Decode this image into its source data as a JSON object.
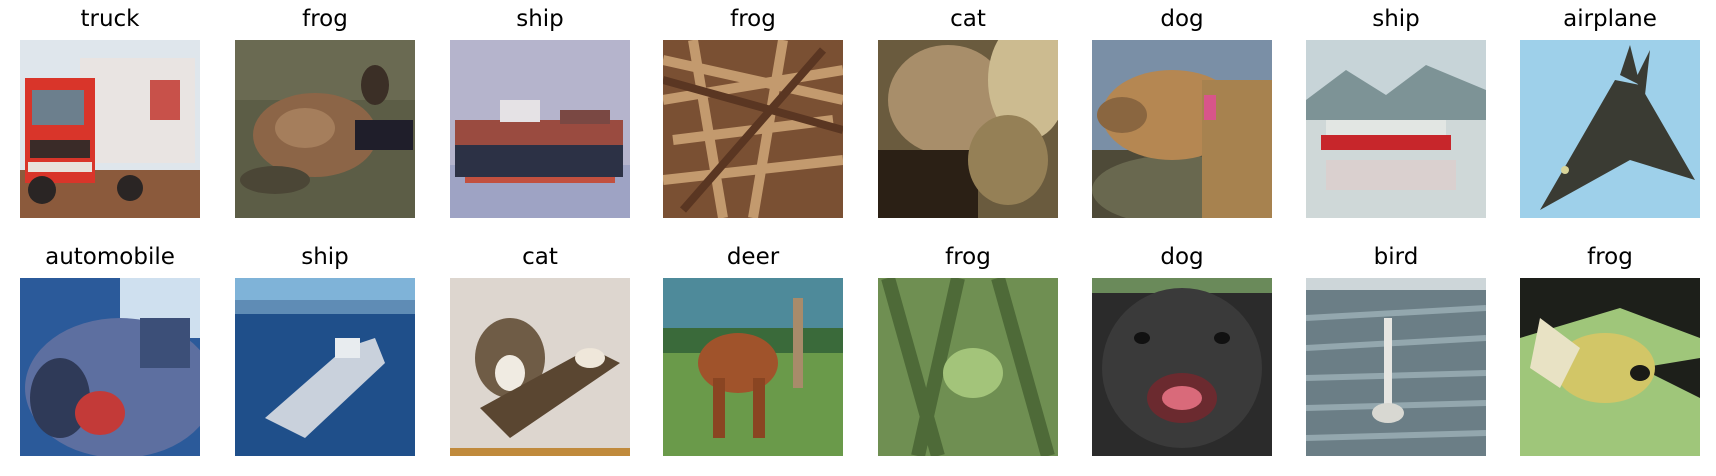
{
  "figure": {
    "rows": [
      [
        {
          "label": "truck",
          "icon": "truck-photo"
        },
        {
          "label": "frog",
          "icon": "frog-photo"
        },
        {
          "label": "ship",
          "icon": "ship-photo"
        },
        {
          "label": "frog",
          "icon": "frog-photo"
        },
        {
          "label": "cat",
          "icon": "cat-photo"
        },
        {
          "label": "dog",
          "icon": "dog-photo"
        },
        {
          "label": "ship",
          "icon": "ship-photo"
        },
        {
          "label": "airplane",
          "icon": "airplane-photo"
        }
      ],
      [
        {
          "label": "automobile",
          "icon": "automobile-photo"
        },
        {
          "label": "ship",
          "icon": "ship-photo"
        },
        {
          "label": "cat",
          "icon": "cat-photo"
        },
        {
          "label": "deer",
          "icon": "deer-photo"
        },
        {
          "label": "frog",
          "icon": "frog-photo"
        },
        {
          "label": "dog",
          "icon": "dog-photo"
        },
        {
          "label": "bird",
          "icon": "bird-photo"
        },
        {
          "label": "frog",
          "icon": "frog-photo"
        }
      ]
    ]
  }
}
